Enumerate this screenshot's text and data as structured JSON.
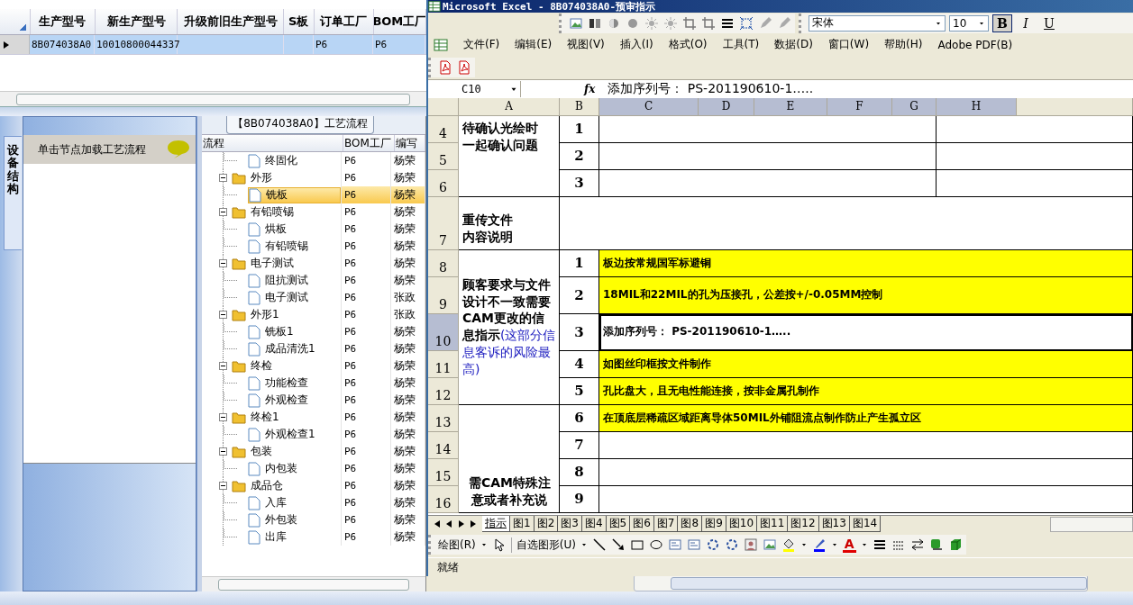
{
  "app_grid": {
    "columns": [
      "生产型号",
      "新生产型号",
      "升级前旧生产型号",
      "S板",
      "订单工厂",
      "BOM工厂"
    ],
    "rows": [
      {
        "selected": true,
        "cells": [
          "8B074038A0",
          "10010800044337",
          null,
          null,
          "P6",
          "P6"
        ]
      }
    ]
  },
  "side_tab": {
    "label": "设备结构",
    "selected": true
  },
  "hint_panel": {
    "title": "单击节点加载工艺流程"
  },
  "process_tab": {
    "label": "【8B074038A0】工艺流程"
  },
  "tree": {
    "columns": [
      "流程",
      "BOM工厂",
      "编写"
    ],
    "leading": [
      {
        "label": "终固化",
        "factory": "P6",
        "author": "杨荣",
        "selected": false
      }
    ],
    "nodes": [
      {
        "label": "外形",
        "factory": "P6",
        "author": "杨荣",
        "expanded": true,
        "selected": false,
        "children": [
          {
            "label": "铣板",
            "factory": "P6",
            "author": "杨荣",
            "selected": true
          }
        ]
      },
      {
        "label": "有铅喷锡",
        "factory": "P6",
        "author": "杨荣",
        "expanded": true,
        "selected": false,
        "children": [
          {
            "label": "烘板",
            "factory": "P6",
            "author": "杨荣",
            "selected": false
          },
          {
            "label": "有铅喷锡",
            "factory": "P6",
            "author": "杨荣",
            "selected": false
          }
        ]
      },
      {
        "label": "电子测试",
        "factory": "P6",
        "author": "杨荣",
        "expanded": true,
        "selected": false,
        "children": [
          {
            "label": "阻抗测试",
            "factory": "P6",
            "author": "杨荣",
            "selected": false
          },
          {
            "label": "电子测试",
            "factory": "P6",
            "author": "张政",
            "selected": false
          }
        ]
      },
      {
        "label": "外形1",
        "factory": "P6",
        "author": "张政",
        "expanded": true,
        "selected": false,
        "children": [
          {
            "label": "铣板1",
            "factory": "P6",
            "author": "杨荣",
            "selected": false
          },
          {
            "label": "成品清洗1",
            "factory": "P6",
            "author": "杨荣",
            "selected": false
          }
        ]
      },
      {
        "label": "终检",
        "factory": "P6",
        "author": "杨荣",
        "expanded": true,
        "selected": false,
        "children": [
          {
            "label": "功能检查",
            "factory": "P6",
            "author": "杨荣",
            "selected": false
          },
          {
            "label": "外观检查",
            "factory": "P6",
            "author": "杨荣",
            "selected": false
          }
        ]
      },
      {
        "label": "终检1",
        "factory": "P6",
        "author": "杨荣",
        "expanded": true,
        "selected": false,
        "children": [
          {
            "label": "外观检查1",
            "factory": "P6",
            "author": "杨荣",
            "selected": false
          }
        ]
      },
      {
        "label": "包装",
        "factory": "P6",
        "author": "杨荣",
        "expanded": true,
        "selected": false,
        "children": [
          {
            "label": "内包装",
            "factory": "P6",
            "author": "杨荣",
            "selected": false
          }
        ]
      },
      {
        "label": "成品仓",
        "factory": "P6",
        "author": "杨荣",
        "expanded": true,
        "selected": false,
        "children": [
          {
            "label": "入库",
            "factory": "P6",
            "author": "杨荣",
            "selected": false
          },
          {
            "label": "外包装",
            "factory": "P6",
            "author": "杨荣",
            "selected": false
          },
          {
            "label": "出库",
            "factory": "P6",
            "author": "杨荣",
            "selected": false
          }
        ]
      }
    ]
  },
  "excel": {
    "title": "Microsoft Excel - 8B074038A0-预审指示",
    "font": "宋体",
    "size": "10",
    "format_buttons": [
      {
        "label": "B",
        "selected": true
      },
      {
        "label": "I",
        "selected": false
      },
      {
        "label": "U",
        "selected": false
      }
    ],
    "menus": [
      "文件(F)",
      "编辑(E)",
      "视图(V)",
      "插入(I)",
      "格式(O)",
      "工具(T)",
      "数据(D)",
      "窗口(W)",
      "帮助(H)",
      "Adobe PDF(B)"
    ],
    "name_box": "C10",
    "fx_label": "fx",
    "formula": "添加序列号： PS-201190610-1…..",
    "columns": [
      {
        "label": "A",
        "selected": false
      },
      {
        "label": "B",
        "selected": false
      },
      {
        "label": "C",
        "selected": true
      },
      {
        "label": "D",
        "selected": true
      },
      {
        "label": "E",
        "selected": true
      },
      {
        "label": "F",
        "selected": true
      },
      {
        "label": "G",
        "selected": true
      },
      {
        "label": "H",
        "selected": true
      }
    ],
    "row_numbers": [
      {
        "label": "4",
        "selected": false
      },
      {
        "label": "5",
        "selected": false
      },
      {
        "label": "6",
        "selected": false
      },
      {
        "label": "7",
        "selected": false
      },
      {
        "label": "8",
        "selected": false
      },
      {
        "label": "9",
        "selected": false
      },
      {
        "label": "10",
        "selected": true
      },
      {
        "label": "11",
        "selected": false
      },
      {
        "label": "12",
        "selected": false
      },
      {
        "label": "13",
        "selected": false
      },
      {
        "label": "14",
        "selected": false
      },
      {
        "label": "15",
        "selected": false
      },
      {
        "label": "16",
        "selected": false
      }
    ],
    "sections": [
      {
        "kind": "blank_rows",
        "lines": [
          "待确认光绘时",
          "一起确认问题"
        ],
        "items": [
          {
            "number": "1"
          },
          {
            "number": "2"
          },
          {
            "number": "3"
          }
        ]
      },
      {
        "kind": "merged",
        "lines": [
          "重传文件",
          "内容说明"
        ]
      },
      {
        "kind": "list",
        "text": "顾客要求与文件设计不一致需要CAM更改的信息指示",
        "note": "(这部分信息客诉的风险最高)",
        "items": [
          {
            "number": "1",
            "text": "板边按常规国军标避铜",
            "highlighted": true,
            "selected": false
          },
          {
            "number": "2",
            "text": "18MIL和22MIL的孔为压接孔，公差按+/-0.05MM控制",
            "highlighted": true,
            "selected": false
          },
          {
            "number": "3",
            "text": "添加序列号： PS-201190610-1…..",
            "highlighted": false,
            "selected": true
          },
          {
            "number": "4",
            "text": "如图丝印框按文件制作",
            "highlighted": true,
            "selected": false
          },
          {
            "number": "5",
            "text": "孔比盘大，且无电性能连接，按非金属孔制作",
            "highlighted": true,
            "selected": false
          }
        ]
      },
      {
        "kind": "list",
        "lines": [
          "需CAM特殊注",
          "意或者补充说"
        ],
        "items": [
          {
            "number": "6",
            "text": "在顶底层稀疏区域距离导体50MIL外铺阻流点制作防止产生孤立区",
            "highlighted": true,
            "selected": false
          },
          {
            "number": "7",
            "highlighted": false,
            "selected": false
          },
          {
            "number": "8",
            "highlighted": false,
            "selected": false
          },
          {
            "number": "9",
            "highlighted": false,
            "selected": false
          }
        ]
      }
    ],
    "sheet_tabs": [
      {
        "label": "指示",
        "selected": true
      },
      {
        "label": "图1",
        "selected": false
      },
      {
        "label": "图2",
        "selected": false
      },
      {
        "label": "图3",
        "selected": false
      },
      {
        "label": "图4",
        "selected": false
      },
      {
        "label": "图5",
        "selected": false
      },
      {
        "label": "图6",
        "selected": false
      },
      {
        "label": "图7",
        "selected": false
      },
      {
        "label": "图8",
        "selected": false
      },
      {
        "label": "图9",
        "selected": false
      },
      {
        "label": "图10",
        "selected": false
      },
      {
        "label": "图11",
        "selected": false
      },
      {
        "label": "图12",
        "selected": false
      },
      {
        "label": "图13",
        "selected": false
      },
      {
        "label": "图14",
        "selected": false
      }
    ],
    "draw_menu": "绘图(R)",
    "autoshape_menu": "自选图形(U)",
    "font_color_label": "A",
    "status": "就绪"
  }
}
